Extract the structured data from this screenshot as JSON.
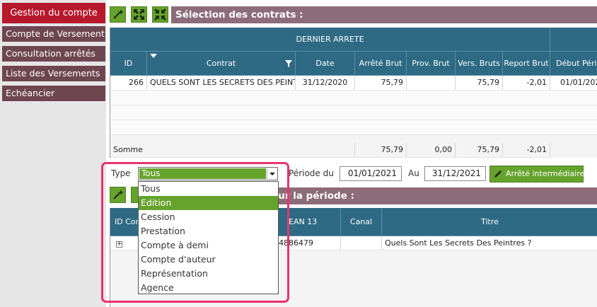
{
  "sidebar": {
    "items": [
      {
        "label": "Gestion du compte",
        "active": true
      },
      {
        "label": "Compte de Versement"
      },
      {
        "label": "Consultation arrêtés"
      },
      {
        "label": "Liste des Versements"
      },
      {
        "label": "Echéancier"
      }
    ]
  },
  "toolbar": {
    "icons": [
      "wand-icon",
      "expand-icon",
      "collapse-icon"
    ]
  },
  "contracts": {
    "title": "Sélection des contrats :",
    "group_header": "DERNIER ARRETE",
    "columns": [
      "ID",
      "Contrat",
      "Date",
      "Arrêté Brut",
      "Prov. Brut",
      "Vers. Bruts",
      "Report Brut",
      "Début Pério"
    ],
    "rows": [
      {
        "id": "266",
        "contrat": "QUELS SONT LES SECRETS DES PEINTF",
        "date": "31/12/2020",
        "arrete": "75,79",
        "prov": "",
        "vers": "75,79",
        "report": "-2,01",
        "debut": "01/01/202"
      }
    ],
    "sum": {
      "label": "Somme",
      "arrete": "75,79",
      "prov": "0,00",
      "vers": "75,79",
      "report": "-2,01"
    }
  },
  "filters": {
    "type_label": "Type",
    "type_value": "Tous",
    "periode_label": "Période du",
    "date_from": "01/01/2021",
    "au_label": "Au",
    "date_to": "31/12/2021",
    "interm_button": "Arrêté intermédiaire"
  },
  "type_options": [
    "Tous",
    "Edition",
    "Cession",
    "Prestation",
    "Compte à demi",
    "Compte d'auteur",
    "Représentation",
    "Agence"
  ],
  "type_highlighted": "Edition",
  "period": {
    "title_fragment": "our la période :",
    "columns": [
      "ID Con",
      "EAN 13",
      "Canal",
      "Titre"
    ],
    "row": {
      "expand": "+",
      "ean": "23-4886479",
      "titre": "Quels Sont Les Secrets Des Peintres ?"
    }
  },
  "colors": {
    "accent_green": "#66a32d",
    "header_blue": "#2e6a84",
    "sidebar_active": "#b6192b",
    "sidebar_item": "#6e4650",
    "section_title": "#8c6c78",
    "highlight_pink": "#e8336e"
  }
}
